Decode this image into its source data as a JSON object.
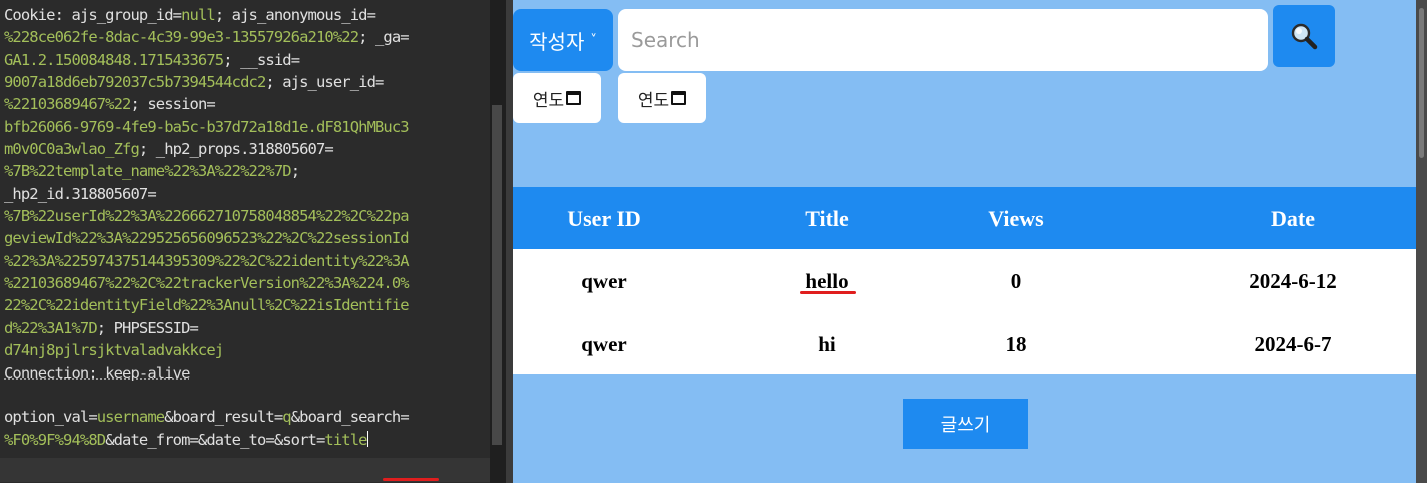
{
  "request": {
    "lines": [
      [
        {
          "t": "Cookie: ajs_group_id=",
          "c": "hdr"
        },
        {
          "t": "null",
          "c": "v"
        },
        {
          "t": "; ajs_anonymous_id=",
          "c": "hdr"
        }
      ],
      [
        {
          "t": "%228ce062fe-8dac-4c39-99e3-13557926a210%22",
          "c": "v"
        },
        {
          "t": "; _ga=",
          "c": "hdr"
        }
      ],
      [
        {
          "t": "GA1.2.150084848.1715433675",
          "c": "v"
        },
        {
          "t": "; __ssid=",
          "c": "hdr"
        }
      ],
      [
        {
          "t": "9007a18d6eb792037c5b7394544cdc2",
          "c": "v"
        },
        {
          "t": "; ajs_user_id=",
          "c": "hdr"
        }
      ],
      [
        {
          "t": "%2210368946 7%22",
          "c": "v"
        },
        {
          "t": "; session=",
          "c": "hdr"
        }
      ],
      [
        {
          "t": "bfb26066-9769-4fe9-ba5c-b37d72a18d1e.dF81QhMBuc3",
          "c": "v"
        }
      ],
      [
        {
          "t": "m0v0C0a3wlao_Zfg",
          "c": "v"
        },
        {
          "t": "; _hp2_props.318805607=",
          "c": "hdr"
        }
      ],
      [
        {
          "t": "%7B%22template_name%22%3A%22%22%7D",
          "c": "v"
        },
        {
          "t": ";",
          "c": "hdr"
        }
      ],
      [
        {
          "t": "_hp2_id.318805607=",
          "c": "hdr"
        }
      ],
      [
        {
          "t": "%7B%22userId%22%3A%22666271075804885 4%22%2C%22pa",
          "c": "v"
        }
      ],
      [
        {
          "t": "geviewId%22%3A%2295256560965 23%22%2C%22sessionId",
          "c": "v"
        }
      ],
      [
        {
          "t": "%22%3A%22597437514439530 9%22%2C%22identity%22%3A",
          "c": "v"
        }
      ],
      [
        {
          "t": "%2210368946 7%22%2C%22trackerVersion%22%3A%224.0%",
          "c": "v"
        }
      ],
      [
        {
          "t": "22%2C%22identityField%22%3Anull%2C%22isIdentifie",
          "c": "v"
        }
      ],
      [
        {
          "t": "d%22%3A1%7D",
          "c": "v"
        },
        {
          "t": "; PHPSESSID=",
          "c": "hdr"
        }
      ],
      [
        {
          "t": "d74nj8pjlrsjktvaladvakkcej",
          "c": "v"
        }
      ],
      [
        {
          "t": "Connection: keep-alive",
          "c": "conn"
        }
      ],
      [
        {
          "t": "",
          "c": "hdr"
        }
      ],
      [
        {
          "t": "option_val=",
          "c": "hdr"
        },
        {
          "t": "username",
          "c": "v"
        },
        {
          "t": "&board_result=",
          "c": "hdr"
        },
        {
          "t": "q",
          "c": "v"
        },
        {
          "t": "&board_search=",
          "c": "hdr"
        }
      ],
      [
        {
          "t": "%F0%9F%94%8D",
          "c": "v"
        },
        {
          "t": "&date_from=&date_to=&sort=",
          "c": "hdr"
        },
        {
          "t": "title",
          "c": "v"
        }
      ]
    ]
  },
  "search": {
    "option_label": "작성자",
    "placeholder": "Search",
    "value": "",
    "date_from_label": "연도",
    "date_to_label": "연도"
  },
  "board": {
    "headers": [
      "User ID",
      "Title",
      "Views",
      "Date"
    ],
    "rows": [
      {
        "user": "qwer",
        "title": "hello",
        "views": "0",
        "date": "2024-6-12"
      },
      {
        "user": "qwer",
        "title": "hi",
        "views": "18",
        "date": "2024-6-7"
      }
    ],
    "write_label": "글쓰기"
  },
  "colors": {
    "accent": "#1e8af0",
    "panel_bg": "#84bdf3",
    "editor_bg": "#2b2b2b",
    "value_text": "#a3bf5a",
    "mark": "#e01e1e"
  },
  "icons": {
    "search": "magnifier-icon",
    "calendar": "calendar-icon",
    "chevron": "chevron-down-icon"
  }
}
